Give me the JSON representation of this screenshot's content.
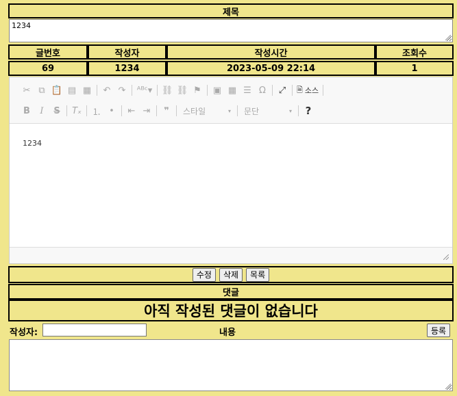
{
  "title_header": "제목",
  "title_value": "1234",
  "info": {
    "headers": [
      "글번호",
      "작성자",
      "작성시간",
      "조회수"
    ],
    "values": [
      "69",
      "1234",
      "2023-05-09 22:14",
      "1"
    ]
  },
  "editor": {
    "style_label": "스타일",
    "format_label": "문단",
    "source_label": "소스",
    "content": "1234"
  },
  "actions": {
    "edit": "수정",
    "delete": "삭제",
    "list": "목록"
  },
  "comments": {
    "header": "댓글",
    "empty_message": "아직 작성된 댓글이 없습니다",
    "author_label": "작성자:",
    "author_value": "",
    "content_label": "내용",
    "submit": "등록",
    "content_value": ""
  }
}
